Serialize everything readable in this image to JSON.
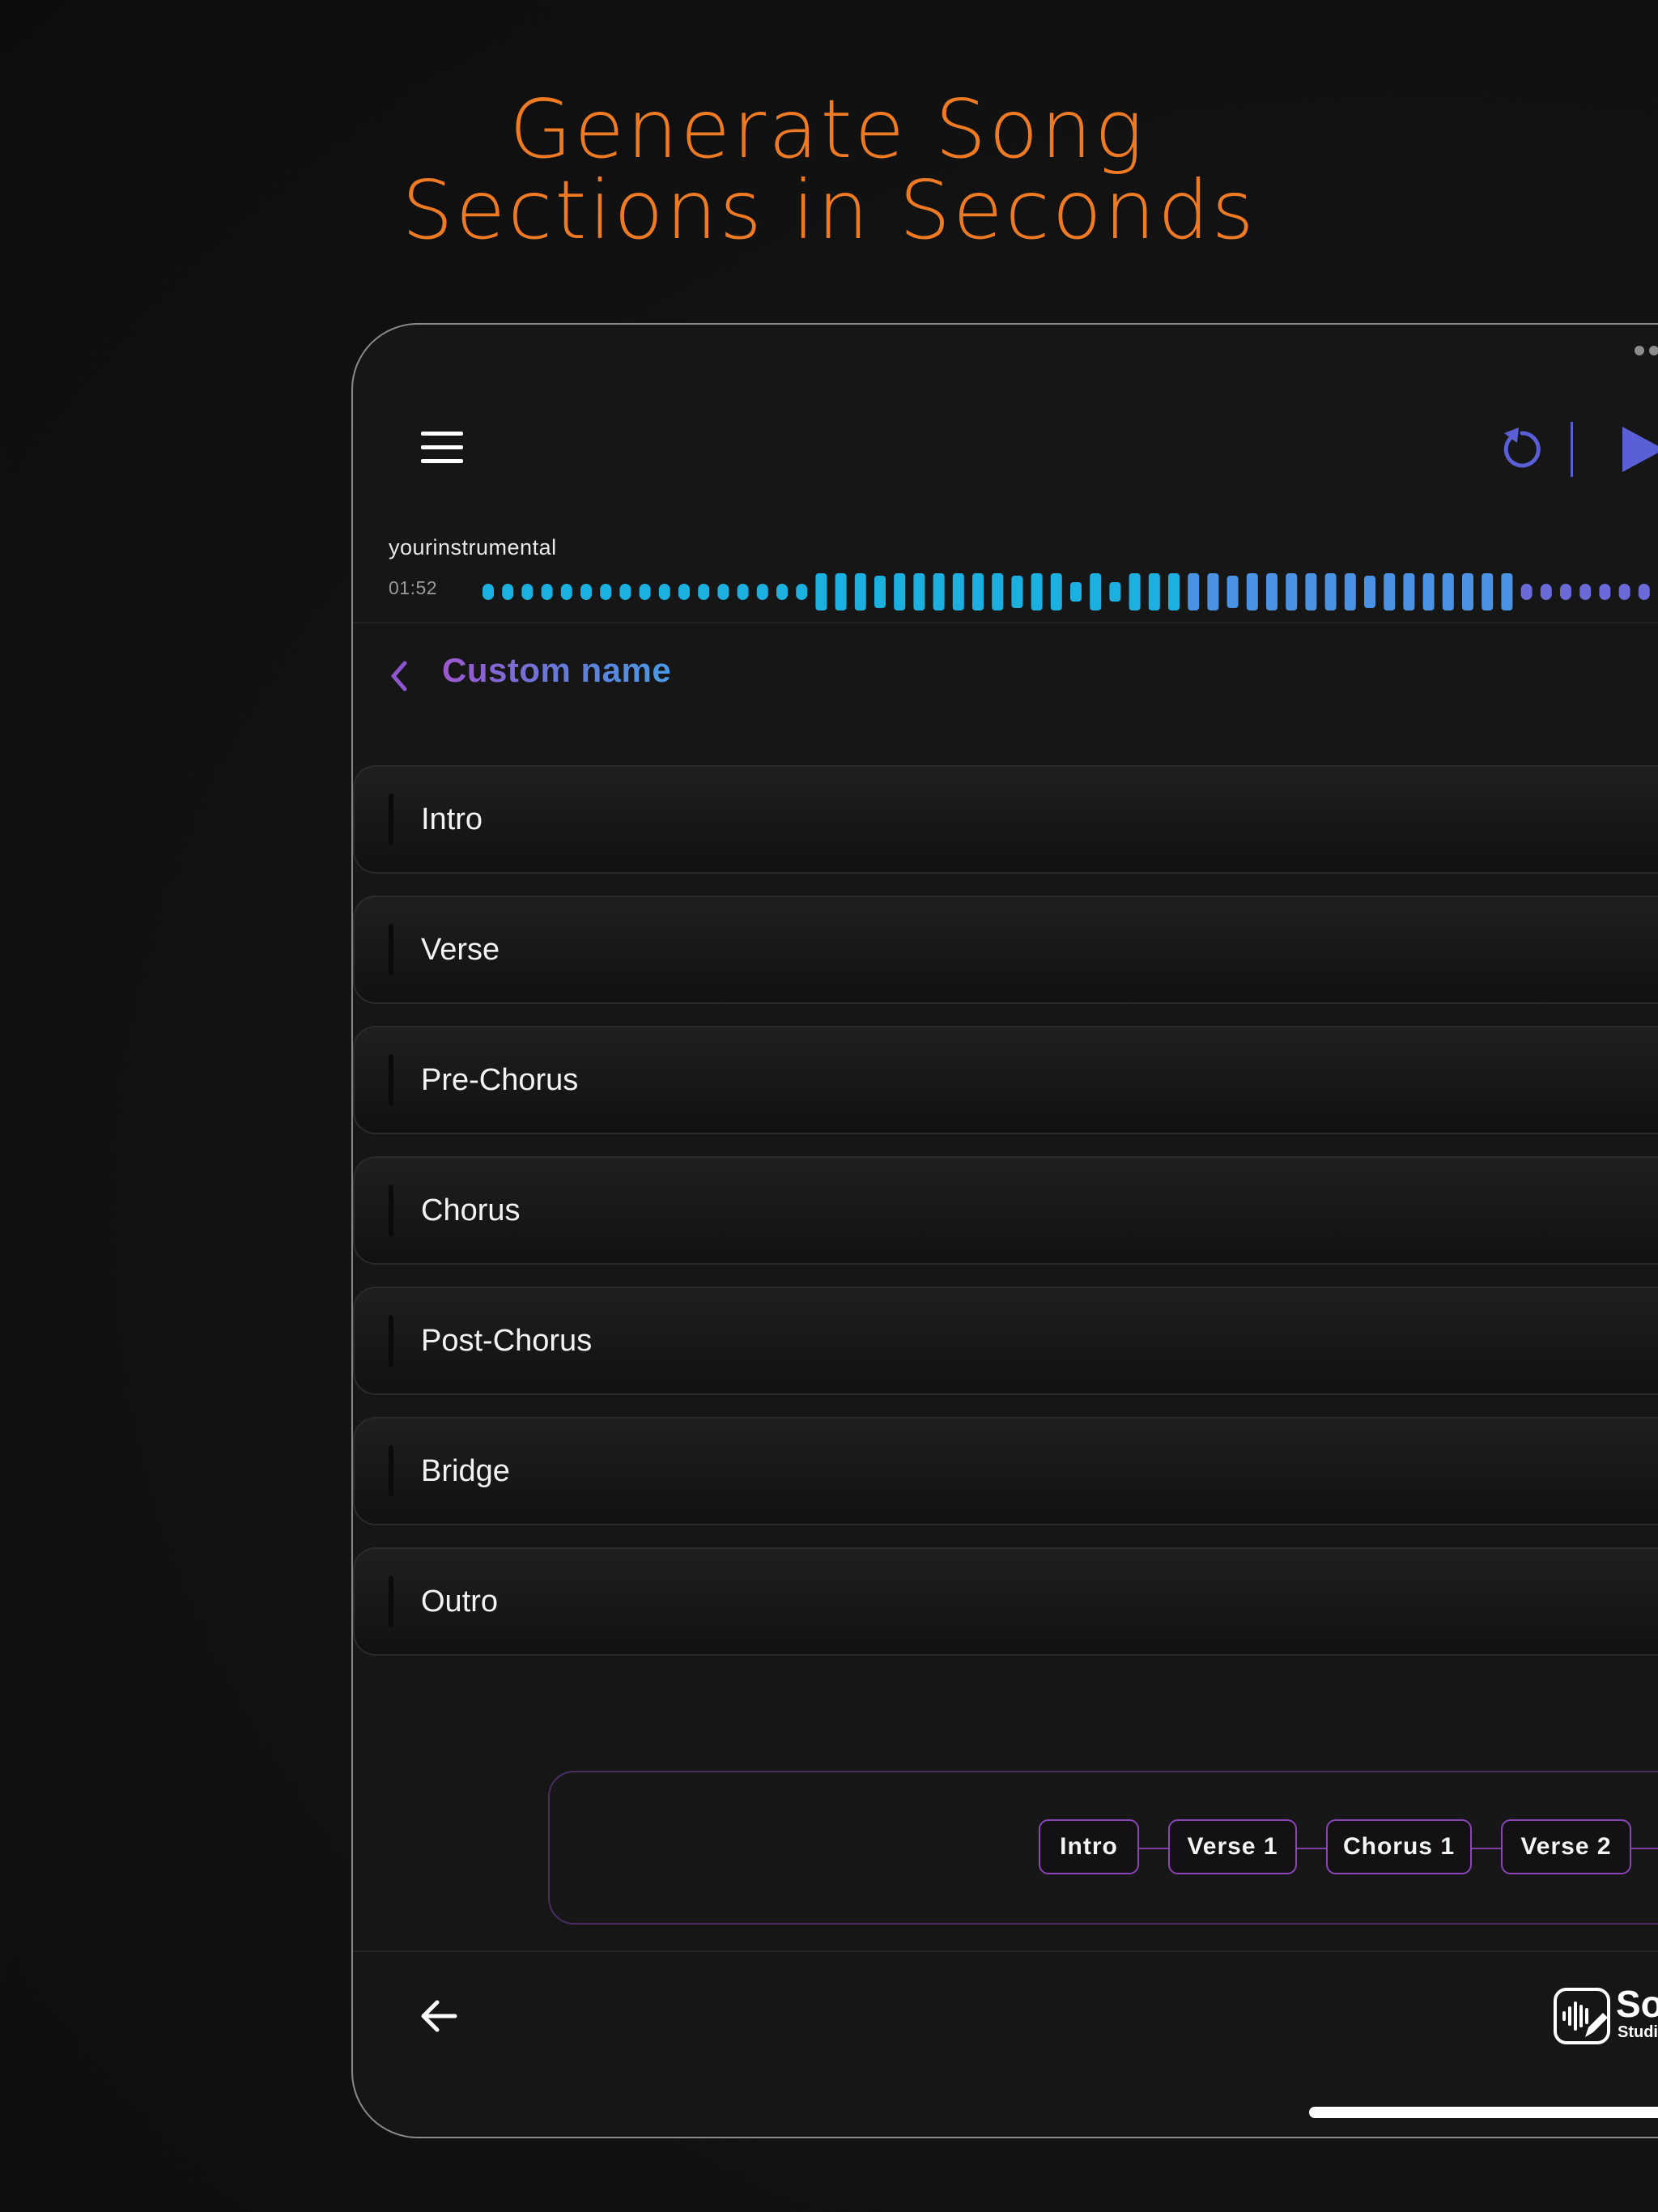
{
  "headline": {
    "line1": "Generate Song",
    "line2": "Sections in Seconds"
  },
  "colors": {
    "headline": "#ee7a24",
    "accent_blue": "#5b5fd6",
    "waveform_cyan": "#1cb0e0",
    "waveform_blue": "#4a92e4",
    "waveform_indigo": "#6a6ad8",
    "chip_border": "#8c45b8"
  },
  "toolbar": {
    "menu_icon": "hamburger-menu-icon",
    "reset_icon": "reset-icon",
    "play_icon": "play-icon"
  },
  "player": {
    "track_name": "yourinstrumental",
    "time": "01:52"
  },
  "page": {
    "title": "Custom name",
    "back_icon": "chevron-left-icon"
  },
  "sections": [
    {
      "label": "Intro"
    },
    {
      "label": "Verse"
    },
    {
      "label": "Pre-Chorus"
    },
    {
      "label": "Chorus"
    },
    {
      "label": "Post-Chorus"
    },
    {
      "label": "Bridge"
    },
    {
      "label": "Outro"
    }
  ],
  "structure": [
    "Intro",
    "Verse 1",
    "Chorus 1",
    "Verse 2"
  ],
  "footer": {
    "back_icon": "arrow-left-icon",
    "logo_text": "So",
    "logo_sub": "Studi"
  }
}
